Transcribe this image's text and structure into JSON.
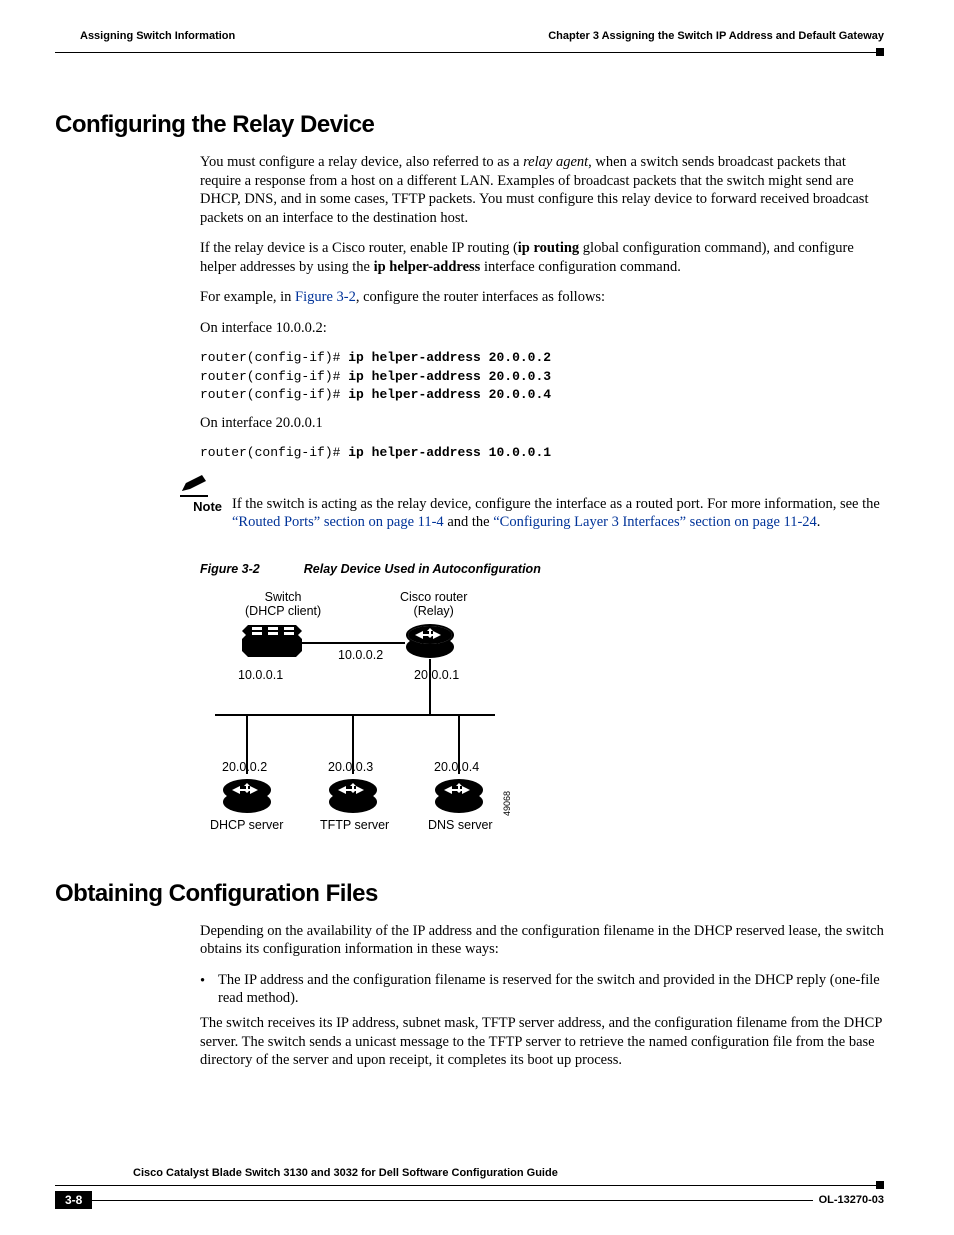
{
  "header": {
    "chapter": "Chapter 3      Assigning the Switch IP Address and Default Gateway",
    "section": "Assigning Switch Information"
  },
  "s1": {
    "title": "Configuring the Relay Device",
    "p1a": "You must configure a relay device, also referred to as a ",
    "p1b": "relay agent",
    "p1c": ", when a switch sends broadcast packets that require a response from a host on a different LAN. Examples of broadcast packets that the switch might send are DHCP, DNS, and in some cases, TFTP packets. You must configure this relay device to forward received broadcast packets on an interface to the destination host.",
    "p2a": "If the relay device is a Cisco router, enable IP routing (",
    "p2b": "ip routing",
    "p2c": " global configuration command), and configure helper addresses by using the ",
    "p2d": "ip helper-address",
    "p2e": " interface configuration command.",
    "p3a": "For example, in ",
    "p3b": "Figure 3-2",
    "p3c": ", configure the router interfaces as follows:",
    "p4": "On interface 10.0.0.2:",
    "code1_prompt": "router(config-if)#",
    "code1_l1": " ip helper-address 20.0.0.2",
    "code1_l2": " ip helper-address 20.0.0.3",
    "code1_l3": " ip helper-address 20.0.0.4",
    "p5": "On interface 20.0.0.1",
    "code2_prompt": "router(config-if)#",
    "code2_l1": " ip helper-address 10.0.0.1"
  },
  "note": {
    "label": "Note",
    "t1": "If the switch is acting as the relay device, configure the interface as a routed port. For more information, see the ",
    "l1": "“Routed Ports” section on page 11-4",
    "t2": " and the ",
    "l2": "“Configuring Layer 3 Interfaces” section on page 11-24",
    "t3": "."
  },
  "fig": {
    "num": "Figure 3-2",
    "title": "Relay Device Used in Autoconfiguration",
    "sw_l1": "Switch",
    "sw_l2": "(DHCP client)",
    "rt_l1": "Cisco router",
    "rt_l2": "(Relay)",
    "ip_sw": "10.0.0.1",
    "ip_rt1": "10.0.0.2",
    "ip_rt2": "20.0.0.1",
    "ip_a": "20.0.0.2",
    "ip_b": "20.0.0.3",
    "ip_c": "20.0.0.4",
    "srv_a": "DHCP server",
    "srv_b": "TFTP server",
    "srv_c": "DNS server",
    "imgid": "49068"
  },
  "s2": {
    "title": "Obtaining Configuration Files",
    "p1": "Depending on the availability of the IP address and the configuration filename in the DHCP reserved lease, the switch obtains its configuration information in these ways:",
    "b1": "The IP address and the configuration filename is reserved for the switch and provided in the DHCP reply (one-file read method).",
    "b1p": "The switch receives its IP address, subnet mask, TFTP server address, and the configuration filename from the DHCP server. The switch sends a unicast message to the TFTP server to retrieve the named configuration file from the base directory of the server and upon receipt, it completes its boot up process."
  },
  "footer": {
    "guide": "Cisco Catalyst Blade Switch 3130 and 3032 for Dell Software Configuration Guide",
    "page": "3-8",
    "doc": "OL-13270-03"
  }
}
